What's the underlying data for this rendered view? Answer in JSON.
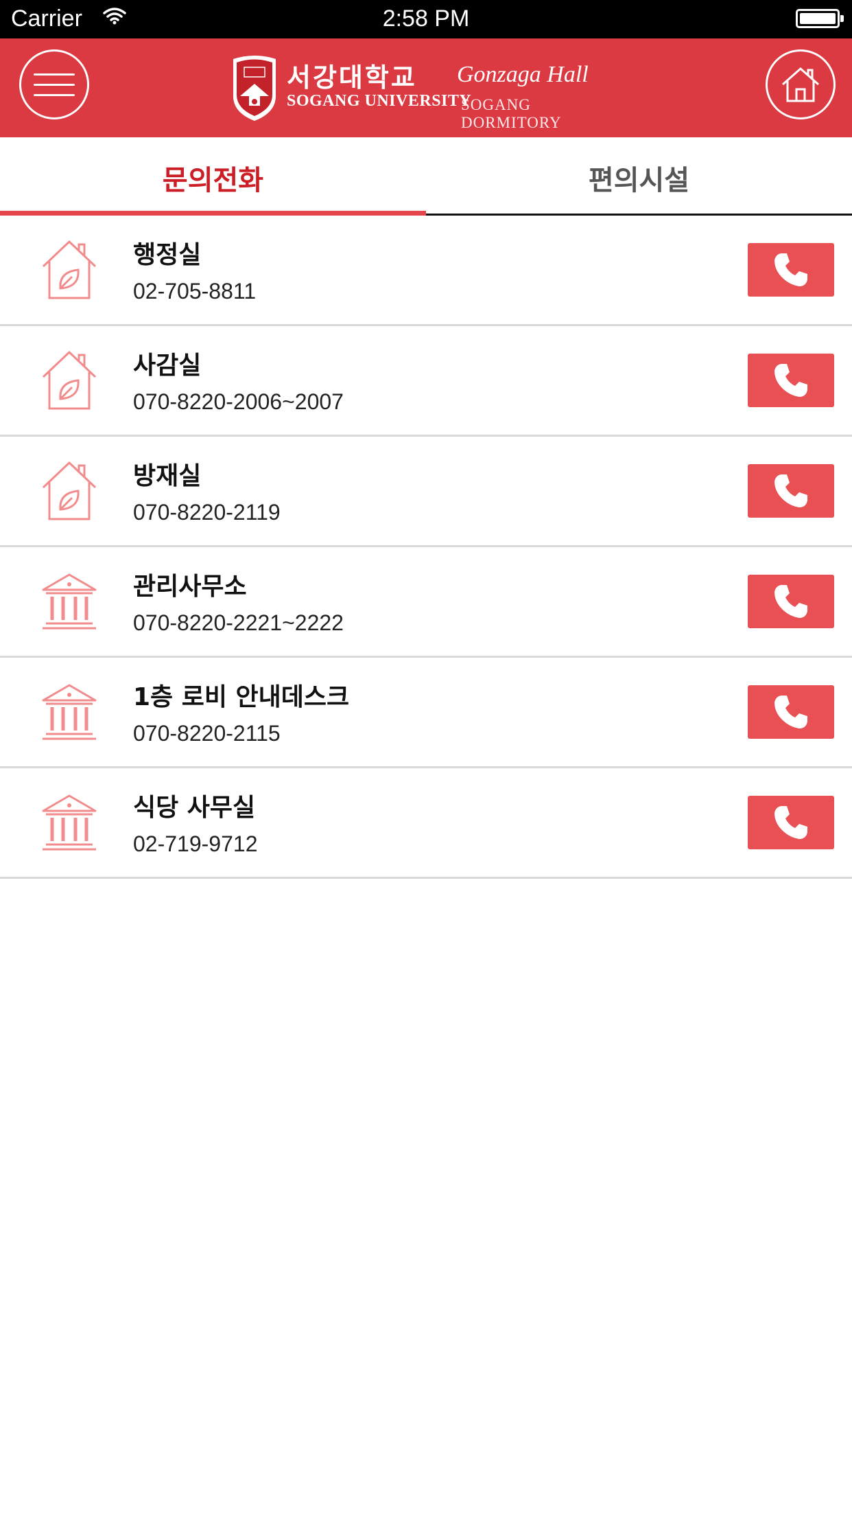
{
  "status_bar": {
    "carrier": "Carrier",
    "time": "2:58 PM"
  },
  "header": {
    "logo_korean": "서강대학교",
    "logo_english": "SOGANG UNIVERSITY",
    "hall_name": "Gonzaga Hall",
    "dorm_label": "SOGANG DORMITORY",
    "menu_icon": "hamburger-menu-icon",
    "home_icon": "home-icon",
    "brand_color": "#dc3a42"
  },
  "tabs": [
    {
      "label": "문의전화",
      "active": true
    },
    {
      "label": "편의시설",
      "active": false
    }
  ],
  "contacts": [
    {
      "name": "행정실",
      "phone": "02-705-8811",
      "icon": "house-leaf-icon"
    },
    {
      "name": "사감실",
      "phone": "070-8220-2006~2007",
      "icon": "house-leaf-icon"
    },
    {
      "name": "방재실",
      "phone": "070-8220-2119",
      "icon": "house-leaf-icon"
    },
    {
      "name": "관리사무소",
      "phone": "070-8220-2221~2222",
      "icon": "building-icon"
    },
    {
      "name": "1층 로비 안내데스크",
      "phone": "070-8220-2115",
      "icon": "building-icon"
    },
    {
      "name": "식당 사무실",
      "phone": "02-719-9712",
      "icon": "building-icon"
    }
  ],
  "colors": {
    "accent": "#e3454b",
    "active_tab_text": "#cc1e26",
    "call_button": "#e95054",
    "icon_stroke": "#f28c8c"
  }
}
